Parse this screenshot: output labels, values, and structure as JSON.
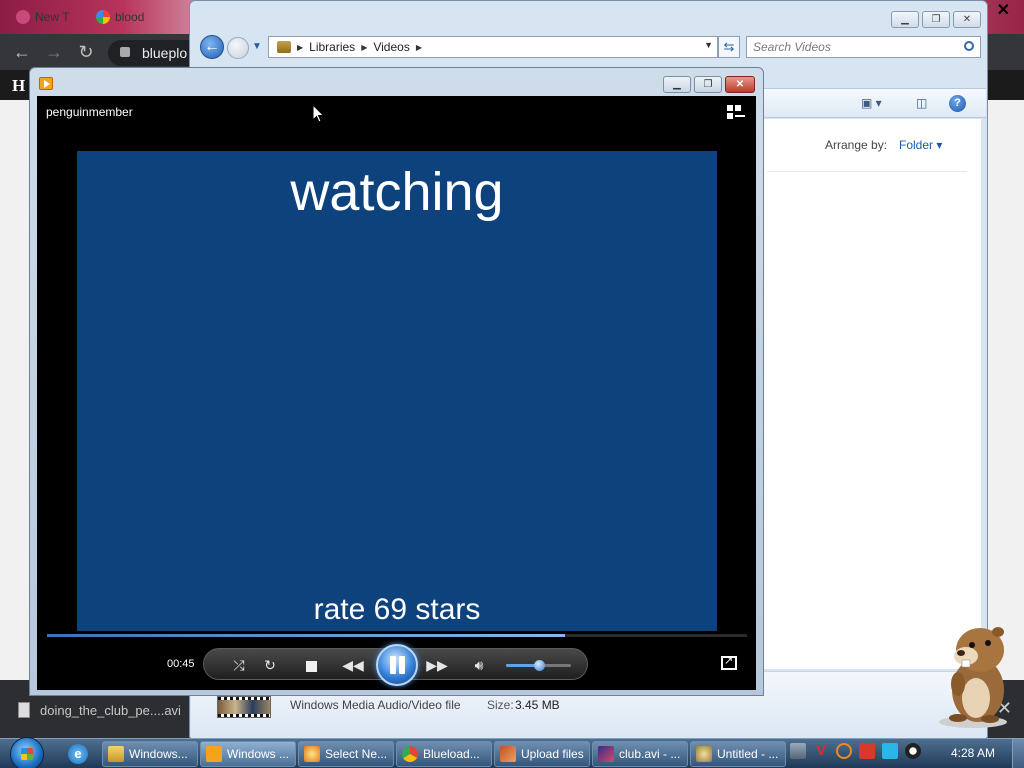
{
  "browser": {
    "tabs": [
      {
        "label": "New T",
        "icon": "flower-favicon"
      },
      {
        "label": "blood",
        "icon": "google-icon"
      }
    ],
    "url": "blueplo",
    "site_logo": "H",
    "colors": {
      "toolbar": "#35363a",
      "tabstrip": "#b8345c"
    }
  },
  "downloads": {
    "file": "doing_the_club_pe....avi"
  },
  "explorer": {
    "breadcrumb": [
      "Libraries",
      "Videos"
    ],
    "search_placeholder": "Search Videos",
    "arrange_label": "Arrange by:",
    "arrange_value": "Folder",
    "details": {
      "file_type": "Windows Media Audio/Video file",
      "size_label": "Size:",
      "size_value": "3.45 MB"
    }
  },
  "player": {
    "user": "penguinmember",
    "video_title": "watching",
    "video_caption": "rate 69 stars",
    "time": "00:45",
    "seek_progress_percent": 74,
    "volume_percent": 50,
    "colors": {
      "video_bg": "#0e427d",
      "accent": "#3480d8"
    }
  },
  "taskbar": {
    "buttons": [
      {
        "label": "Windows...",
        "icon": "folder-icon",
        "active": false
      },
      {
        "label": "Windows ...",
        "icon": "media-player-icon",
        "active": true
      },
      {
        "label": "Select Ne...",
        "icon": "paint-icon",
        "active": false
      },
      {
        "label": "Blueload...",
        "icon": "chrome-icon",
        "active": false
      },
      {
        "label": "Upload files",
        "icon": "upload-icon",
        "active": false
      },
      {
        "label": "club.avi - ...",
        "icon": "video-editor-icon",
        "active": false
      },
      {
        "label": "Untitled - ...",
        "icon": "paint-palette-icon",
        "active": false
      }
    ],
    "clock": "4:28 AM"
  }
}
